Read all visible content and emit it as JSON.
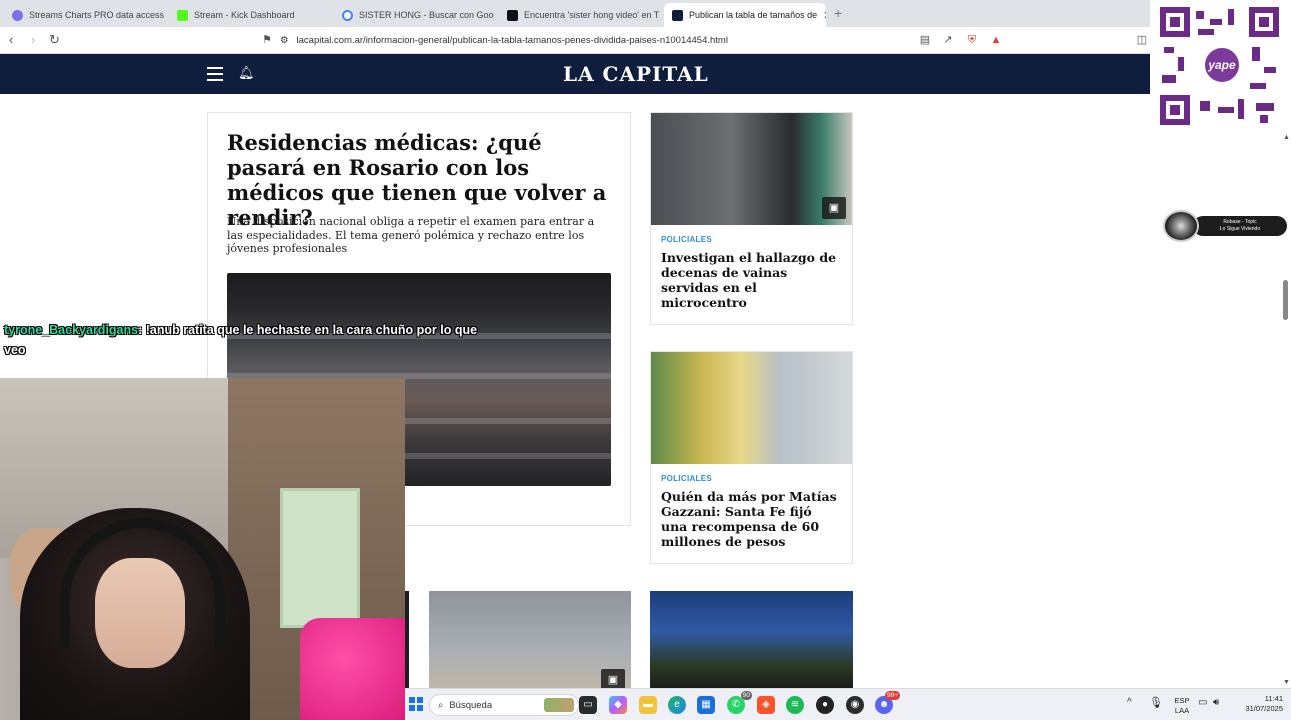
{
  "browser": {
    "tabs": [
      {
        "label": "Streams Charts PRO data access - Str",
        "active": false
      },
      {
        "label": "Stream - Kick Dashboard",
        "active": false
      },
      {
        "label": "SISTER HONG - Buscar con Google",
        "active": false
      },
      {
        "label": "Encuentra 'sister hong video' en TikT",
        "active": false
      },
      {
        "label": "Publican la tabla de tamaños de",
        "active": true
      }
    ],
    "url": "lacapital.com.ar/informacion-general/publican-la-tabla-tamanos-penes-dividida-paises-n10014454.html",
    "extension_badge": "0"
  },
  "site": {
    "logo": "LA CAPITAL",
    "main_article": {
      "title": "Residencias médicas: ¿qué pasará en Rosario con los médicos que tienen que volver a rendir?",
      "subtitle": "Una disposición nacional obliga a repetir el examen para entrar a las especialidades. El tema generó polémica y rechazo entre los jóvenes profesionales"
    },
    "side_articles": [
      {
        "category": "POLICIALES",
        "title": "Investigan el hallazgo de decenas de vainas servidas en el microcentro"
      },
      {
        "category": "POLICIALES",
        "title": "Quién da más por Matías Gazzani: Santa Fe fijó una recompensa de 60 millones de pesos"
      }
    ]
  },
  "overlay": {
    "chat_user": "tyrone_Backyardigans",
    "chat_message": ": !anub ratita que le hechaste en la cara chuño por lo que veo",
    "qr_label": "yape",
    "music_title": "Rebase - Topic",
    "music_sub": "Lo Sigue Viviendo"
  },
  "taskbar": {
    "search_placeholder": "Búsqueda",
    "whatsapp_badge": "90",
    "discord_badge": "99+",
    "language": "ESP",
    "language_sub": "LAA",
    "time": "11:41",
    "date": "31/07/2025"
  },
  "colors": {
    "header_bg": "#0f1e3c",
    "category_color": "#2f8fd8",
    "chat_user_color": "#32d6a0"
  }
}
